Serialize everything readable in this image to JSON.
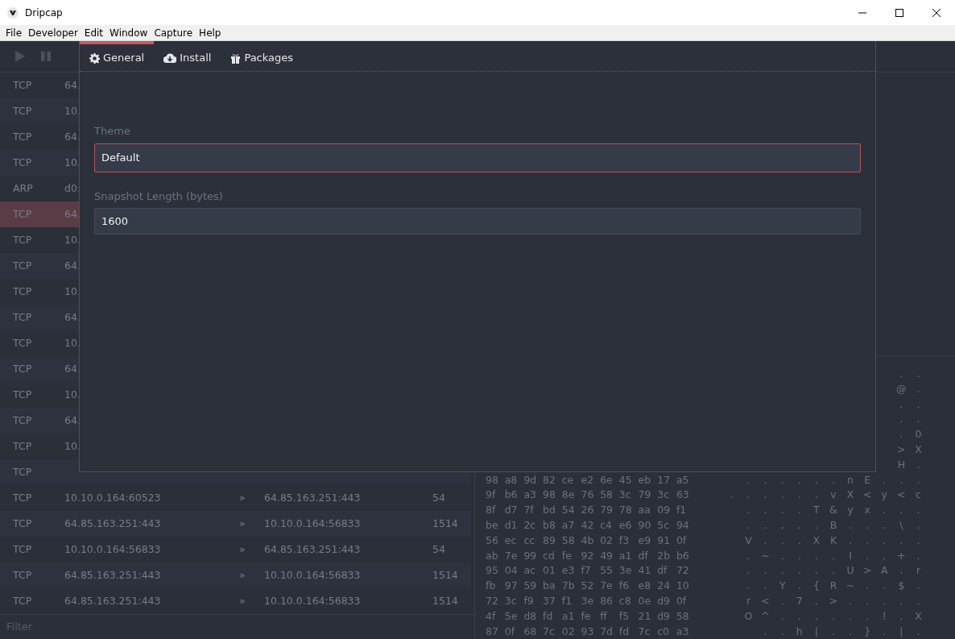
{
  "window": {
    "title": "Dripcap"
  },
  "menu": [
    {
      "label": "File"
    },
    {
      "label": "Developer"
    },
    {
      "label": "Edit"
    },
    {
      "label": "Window"
    },
    {
      "label": "Capture"
    },
    {
      "label": "Help"
    }
  ],
  "packets": [
    {
      "protocol": "TCP",
      "source": "64.",
      "selected": false
    },
    {
      "protocol": "TCP",
      "source": "10.",
      "selected": false
    },
    {
      "protocol": "TCP",
      "source": "64.",
      "selected": false
    },
    {
      "protocol": "TCP",
      "source": "10.",
      "selected": false
    },
    {
      "protocol": "ARP",
      "source": "d0:",
      "selected": false
    },
    {
      "protocol": "TCP",
      "source": "64.",
      "selected": true
    },
    {
      "protocol": "TCP",
      "source": "10.",
      "selected": false
    },
    {
      "protocol": "TCP",
      "source": "64.",
      "selected": false
    },
    {
      "protocol": "TCP",
      "source": "10.",
      "selected": false
    },
    {
      "protocol": "TCP",
      "source": "64.",
      "selected": false
    },
    {
      "protocol": "TCP",
      "source": "10.",
      "selected": false
    },
    {
      "protocol": "TCP",
      "source": "64.",
      "selected": false
    },
    {
      "protocol": "TCP",
      "source": "10.",
      "selected": false
    },
    {
      "protocol": "TCP",
      "source": "64.",
      "selected": false
    },
    {
      "protocol": "TCP",
      "source": "10.",
      "selected": false
    },
    {
      "protocol": "TCP",
      "selected": false
    },
    {
      "protocol": "TCP",
      "source": "10.10.0.164:60523",
      "arrow": "»",
      "destination": "64.85.163.251:443",
      "length": "54",
      "selected": false
    },
    {
      "protocol": "TCP",
      "source": "64.85.163.251:443",
      "arrow": "»",
      "destination": "10.10.0.164:56833",
      "length": "1514",
      "selected": false
    },
    {
      "protocol": "TCP",
      "source": "10.10.0.164:56833",
      "arrow": "»",
      "destination": "64.85.163.251:443",
      "length": "54",
      "selected": false
    },
    {
      "protocol": "TCP",
      "source": "64.85.163.251:443",
      "arrow": "»",
      "destination": "10.10.0.164:56833",
      "length": "1514",
      "selected": false
    },
    {
      "protocol": "TCP",
      "source": "64.85.163.251:443",
      "arrow": "»",
      "destination": "10.10.0.164:56833",
      "length": "1514",
      "selected": false
    }
  ],
  "filter": {
    "placeholder": "Filter"
  },
  "hex_rows": [
    {
      "ascii": [
        ".",
        "."
      ]
    },
    {
      "ascii": [
        "@",
        "."
      ]
    },
    {
      "ascii": [
        ".",
        "."
      ]
    },
    {
      "ascii": [
        ".",
        "."
      ]
    },
    {
      "ascii": [
        ".",
        "0"
      ]
    },
    {
      "ascii": [
        ">",
        "X"
      ]
    },
    {
      "ascii": [
        "H",
        "."
      ]
    },
    {
      "bytes": [
        "98",
        "a8",
        "9d",
        "82",
        "ce",
        "e2",
        "6e",
        "45",
        "eb",
        "17",
        "a5"
      ],
      "ascii": [
        ".",
        ".",
        ".",
        ".",
        ".",
        ".",
        "n",
        "E",
        ".",
        ".",
        "."
      ]
    },
    {
      "bytes": [
        "9f",
        "b6",
        "a3",
        "98",
        "8e",
        "76",
        "58",
        "3c",
        "79",
        "3c",
        "63"
      ],
      "ascii": [
        ".",
        ".",
        ".",
        ".",
        ".",
        ".",
        "v",
        "X",
        "<",
        "y",
        "<",
        "c"
      ]
    },
    {
      "bytes": [
        "8f",
        "d7",
        "7f",
        "bd",
        "54",
        "26",
        "79",
        "78",
        "aa",
        "09",
        "f1"
      ],
      "ascii": [
        ".",
        ".",
        ".",
        ".",
        "T",
        "&",
        "y",
        "x",
        ".",
        ".",
        "."
      ]
    },
    {
      "bytes": [
        "be",
        "d1",
        "2c",
        "b8",
        "a7",
        "42",
        "c4",
        "e6",
        "90",
        "5c",
        "94"
      ],
      "ascii": [
        ".",
        ".",
        ",",
        ".",
        ".",
        "B",
        ".",
        ".",
        ".",
        "\\",
        "."
      ]
    },
    {
      "bytes": [
        "56",
        "ec",
        "cc",
        "89",
        "58",
        "4b",
        "02",
        "f3",
        "e9",
        "91",
        "0f"
      ],
      "ascii": [
        "V",
        ".",
        ".",
        ".",
        "X",
        "K",
        ".",
        ".",
        ".",
        ".",
        "."
      ]
    },
    {
      "bytes": [
        "ab",
        "7e",
        "99",
        "cd",
        "fe",
        "92",
        "49",
        "a1",
        "df",
        "2b",
        "b6"
      ],
      "ascii": [
        ".",
        "~",
        ".",
        ".",
        ".",
        ".",
        "I",
        ".",
        ".",
        "+",
        "."
      ]
    },
    {
      "bytes": [
        "95",
        "04",
        "ac",
        "01",
        "e3",
        "f7",
        "55",
        "3e",
        "41",
        "df",
        "72"
      ],
      "ascii": [
        ".",
        ".",
        ".",
        ".",
        ".",
        ".",
        "U",
        ">",
        "A",
        ".",
        "r"
      ]
    },
    {
      "bytes": [
        "fb",
        "97",
        "59",
        "ba",
        "7b",
        "52",
        "7e",
        "f6",
        "e8",
        "24",
        "10"
      ],
      "ascii": [
        ".",
        ".",
        "Y",
        ".",
        "{",
        "R",
        "~",
        ".",
        ".",
        "$",
        "."
      ]
    },
    {
      "bytes": [
        "72",
        "3c",
        "f9",
        "37",
        "f1",
        "3e",
        "86",
        "c8",
        "0e",
        "d9",
        "0f"
      ],
      "ascii": [
        "r",
        "<",
        ".",
        "7",
        ".",
        ">",
        ".",
        ".",
        ".",
        ".",
        "."
      ]
    },
    {
      "bytes": [
        "4f",
        "5e",
        "d8",
        "fd",
        "a1",
        "fe",
        "ff",
        "f5",
        "21",
        "d9",
        "58"
      ],
      "ascii": [
        "O",
        "^",
        ".",
        ".",
        ".",
        ".",
        ".",
        ".",
        "!",
        ".",
        "X"
      ]
    },
    {
      "bytes": [
        "87",
        "0f",
        "68",
        "7c",
        "02",
        "93",
        "7d",
        "fd",
        "7c",
        "c0",
        "a3"
      ],
      "ascii": [
        ".",
        ".",
        "h",
        "|",
        ".",
        ".",
        "}",
        ".",
        "|",
        "."
      ]
    }
  ],
  "dialog": {
    "tabs": [
      {
        "label": "General",
        "selected": true
      },
      {
        "label": "Install",
        "selected": false
      },
      {
        "label": "Packages",
        "selected": false
      }
    ],
    "fields": [
      {
        "label": "Theme",
        "value": "Default",
        "focused": true
      },
      {
        "label": "Snapshot Length (bytes)",
        "value": "1600",
        "focused": false
      }
    ]
  }
}
